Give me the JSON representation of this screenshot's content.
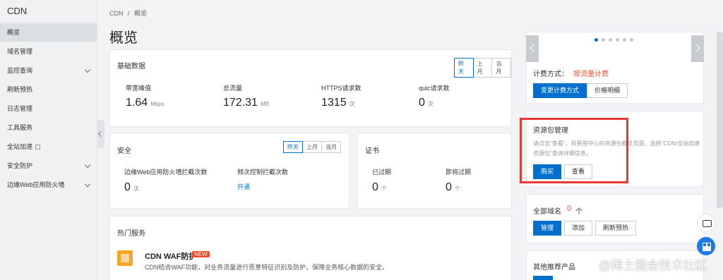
{
  "sidebar": {
    "title": "CDN",
    "items": [
      {
        "label": "概览",
        "active": true,
        "expandable": false
      },
      {
        "label": "域名管理",
        "expandable": false
      },
      {
        "label": "监控查询",
        "expandable": true
      },
      {
        "label": "刷新预热",
        "expandable": false
      },
      {
        "label": "日志管理",
        "expandable": false
      },
      {
        "label": "工具服务",
        "expandable": false
      },
      {
        "label": "全站加速",
        "expandable": false,
        "external": true
      },
      {
        "label": "安全防护",
        "expandable": true
      },
      {
        "label": "边缘Web应用防火墙",
        "expandable": true
      }
    ]
  },
  "breadcrumb": {
    "root": "CDN",
    "sep": "/",
    "current": "概览"
  },
  "page_title": "概览",
  "basic_data": {
    "title": "基础数据",
    "ranges": [
      "昨天",
      "上月",
      "当月"
    ],
    "active_range": "昨天",
    "metrics": [
      {
        "label": "带宽峰值",
        "value": "1.64",
        "unit": "Mbps"
      },
      {
        "label": "总流量",
        "value": "172.31",
        "unit": "MB"
      },
      {
        "label": "HTTPS请求数",
        "value": "1315",
        "unit": "次"
      },
      {
        "label": "quic请求数",
        "value": "0",
        "unit": "次"
      }
    ]
  },
  "security": {
    "title": "安全",
    "ranges": [
      "昨天",
      "上月",
      "当月"
    ],
    "active_range": "昨天",
    "waf_label": "边缘Web应用防火墙拦截次数",
    "waf_value": "0",
    "waf_unit": "次",
    "freq_label": "频次控制拦截次数",
    "freq_link": "开通"
  },
  "certificate": {
    "title": "证书",
    "expired_label": "已过期",
    "expired_value": "0",
    "expired_unit": "个",
    "expiring_label": "即将过期",
    "expiring_value": "0",
    "expiring_unit": "个"
  },
  "hot_services": {
    "title": "热门服务",
    "item_name": "CDN WAF防护",
    "item_badge": "NEW",
    "item_desc": "CDN结合WAF功能，对业务流量进行恶意特征识别及防护，保障业务核心数据的安全。"
  },
  "billing": {
    "label": "计费方式：",
    "value": "按流量计费",
    "change_btn": "变更计费方式",
    "detail_btn": "价格明细"
  },
  "resource_pack": {
    "title": "资源包管理",
    "hint": "请点击\"查看\"，到费用中心的资源包概览页面，选择\"CDN/全站加速资源包\"查询详细信息。",
    "buy_btn": "购买",
    "view_btn": "查看"
  },
  "domains": {
    "label": "全部域名",
    "count": "0",
    "unit": "个",
    "manage_btn": "管理",
    "add_btn": "添加",
    "refresh_btn": "刷新预热"
  },
  "other_products": {
    "title": "其他推荐产品"
  },
  "carousel": {
    "dots": 6,
    "active": 0
  },
  "watermark": "@稀土掘金技术社区",
  "colors": {
    "accent": "#0070cc",
    "price": "#e8542f",
    "highlight": "#e53935"
  }
}
